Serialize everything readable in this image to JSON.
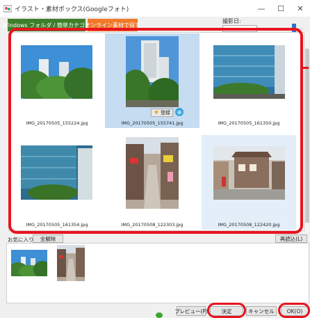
{
  "window": {
    "title": "イラスト・素材ボックス(Googleフォト)",
    "minimize": "—",
    "maximize": "☐",
    "close": "✕"
  },
  "tabs": [
    {
      "label": "Windows フォルダ / 簡単カテゴリ",
      "color": "#3d7f2a"
    },
    {
      "label": "オンライン素材で探す",
      "color": "#f07a2a"
    }
  ],
  "filter": {
    "date_label": "撮影日:"
  },
  "images": [
    {
      "filename": "IMG_20170505_155224.jpg",
      "state": "normal"
    },
    {
      "filename": "IMG_20170505_155741.jpg",
      "state": "selected",
      "star_label": "登録"
    },
    {
      "filename": "IMG_20170505_161350.jpg",
      "state": "normal"
    },
    {
      "filename": "IMG_20170505_161354.jpg",
      "state": "normal"
    },
    {
      "filename": "IMG_20170508_122303.jpg",
      "state": "normal"
    },
    {
      "filename": "IMG_20170508_122420.jpg",
      "state": "hover"
    }
  ],
  "favorites": {
    "label": "お気に入り",
    "clear_all": "全解除",
    "reload": "再読込(L)"
  },
  "footer": {
    "preview": "プレビュー(P)",
    "decide": "決定",
    "cancel": "キャンセル",
    "ok": "OK(O)"
  },
  "accent": {
    "highlight": "#e8141e",
    "selection": "#c5dcf1"
  }
}
